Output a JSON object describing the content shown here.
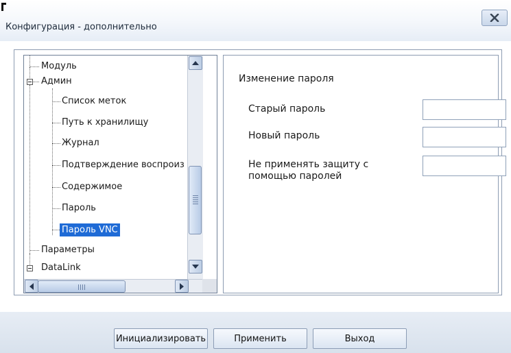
{
  "window": {
    "title": "Конфигурация - дополнительно",
    "close_icon": "close-x-icon"
  },
  "tree": {
    "items": [
      {
        "label": "Модуль",
        "level": 0
      },
      {
        "label": "Админ",
        "level": 0,
        "expanded": true
      },
      {
        "label": "Список меток",
        "level": 1
      },
      {
        "label": "Путь к хранилищу",
        "level": 1
      },
      {
        "label": "Журнал",
        "level": 1
      },
      {
        "label": "Подтверждение воспроиз",
        "level": 1
      },
      {
        "label": "Содержимое",
        "level": 1
      },
      {
        "label": "Пароль",
        "level": 1
      },
      {
        "label": "Пароль VNC",
        "level": 1,
        "selected": true
      },
      {
        "label": "Параметры",
        "level": 0
      },
      {
        "label": "DataLink",
        "level": 0
      }
    ],
    "selected_color": "#1f6bd6"
  },
  "settings": {
    "section_title": "Изменение пароля",
    "fields": [
      {
        "label": "Старый пароль",
        "value": ""
      },
      {
        "label": "Новый пароль",
        "value": ""
      },
      {
        "label": "Не применять защиту с помощью паролей",
        "value": ""
      }
    ]
  },
  "buttons": {
    "initialize": "Инициализировать",
    "apply": "Применить",
    "exit": "Выход"
  },
  "icons": {
    "scroll_up": "arrow-up-icon",
    "scroll_down": "arrow-down-icon",
    "scroll_left": "arrow-left-icon",
    "scroll_right": "arrow-right-icon"
  }
}
